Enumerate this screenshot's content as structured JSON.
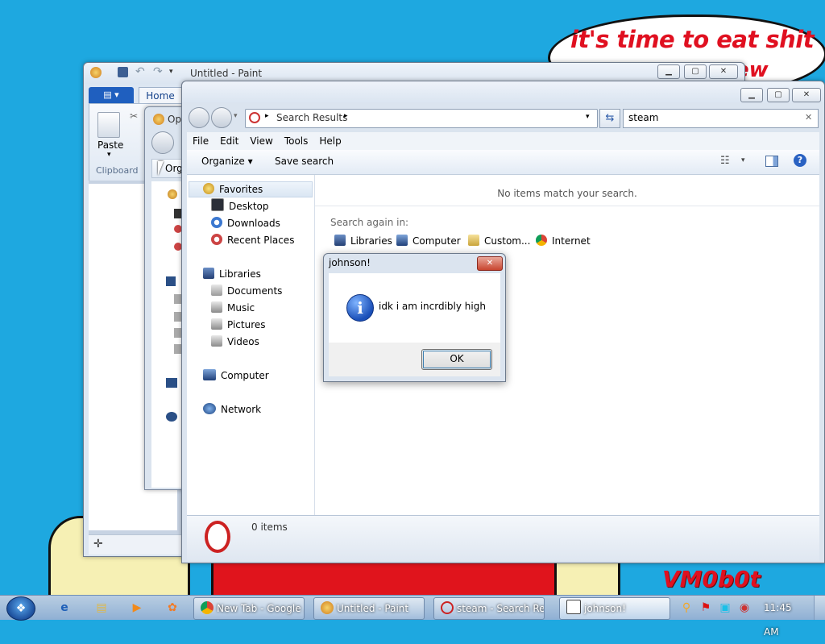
{
  "wallpaper": {
    "speech_line1": "it's time to eat shit",
    "speech_line2": "ew",
    "signature": "VM0b0t"
  },
  "paint": {
    "title": "Untitled - Paint",
    "file_tab": "▤ ▾",
    "home_tab": "Home",
    "paste_label": "Paste",
    "clipboard_label": "Clipboard"
  },
  "open_dialog": {
    "title_partial": "Op",
    "organize_partial": "Org"
  },
  "explorer": {
    "title": "",
    "address": "Search Results",
    "search_value": "steam",
    "menu": [
      "File",
      "Edit",
      "View",
      "Tools",
      "Help"
    ],
    "organize": "Organize ▾",
    "save_search": "Save search",
    "nav": {
      "favorites": "Favorites",
      "desktop": "Desktop",
      "downloads": "Downloads",
      "recent": "Recent Places",
      "libraries": "Libraries",
      "documents": "Documents",
      "music": "Music",
      "pictures": "Pictures",
      "videos": "Videos",
      "computer": "Computer",
      "network": "Network"
    },
    "no_items": "No items match your search.",
    "search_again": "Search again in:",
    "search_locations": [
      "Libraries",
      "Computer",
      "Custom...",
      "Internet"
    ],
    "item_count": "0 items"
  },
  "msgbox": {
    "title": "johnson!",
    "message": "idk i am incrdibly high",
    "ok": "OK",
    "close": "✕"
  },
  "taskbar": {
    "tasks": [
      "New Tab - Google ...",
      "Untitled - Paint",
      "steam - Search Re...",
      "johnson!"
    ],
    "clock": "11:45 AM"
  },
  "colors": {
    "wallpaper": "#1ea8e0",
    "speech_text": "#e01020",
    "selection": "#3c7fb1"
  }
}
